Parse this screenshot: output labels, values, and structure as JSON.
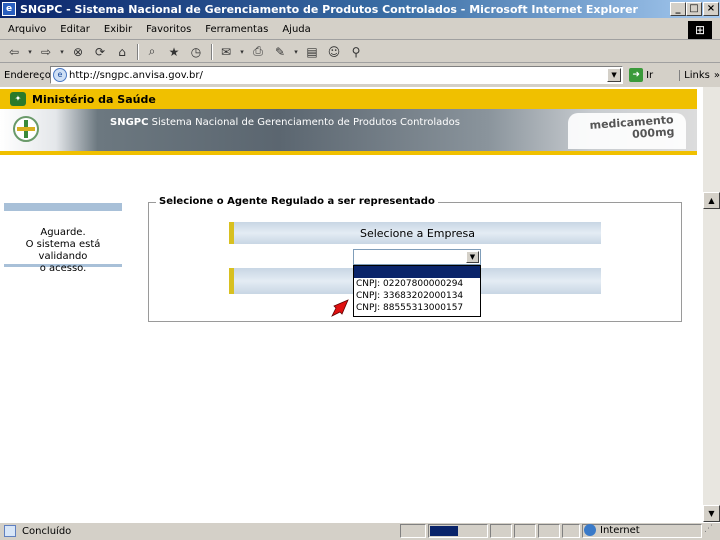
{
  "window": {
    "title": "SNGPC - Sistema Nacional de Gerenciamento de Produtos Controlados - Microsoft Internet Explorer",
    "buttons": {
      "minimize": "_",
      "maximize": "□",
      "close": "×"
    }
  },
  "menubar": {
    "items": [
      "Arquivo",
      "Editar",
      "Exibir",
      "Favoritos",
      "Ferramentas",
      "Ajuda"
    ]
  },
  "toolbar": {
    "icons": [
      "back-icon",
      "dropdown-icon",
      "forward-icon",
      "dropdown-icon",
      "stop-icon",
      "refresh-icon",
      "home-icon",
      "search-icon",
      "favorites-icon",
      "history-icon",
      "mail-icon",
      "print-icon",
      "edit-icon",
      "discuss-icon",
      "messenger-icon",
      "research-icon"
    ]
  },
  "addressbar": {
    "label": "Endereço",
    "url": "http://sngpc.anvisa.gov.br/",
    "go_label": "Ir",
    "links_label": "Links"
  },
  "banner": {
    "ministerio": "Ministério da Saúde",
    "sngpc_bold": "SNGPC",
    "sngpc_rest": " Sistema Nacional de Gerenciamento de Produtos Controlados",
    "med_line1": "medicamento",
    "med_line2": "000mg"
  },
  "sidebar": {
    "line1": "Aguarde.",
    "line2": "O sistema está validando",
    "line3": "o acesso."
  },
  "form": {
    "legend": "Selecione o Agente Regulado a ser representado",
    "header": "Selecione a Empresa",
    "select_value": "",
    "options": [
      "",
      "CNPJ: 02207800000294",
      "CNPJ: 33683202000134",
      "CNPJ: 88555313000157"
    ]
  },
  "statusbar": {
    "status": "Concluído",
    "progress": 0.5,
    "zone": "Internet"
  },
  "colors": {
    "title_blue": "#0a246a",
    "banner_yellow": "#f0c000",
    "selection_highlight": "#0a246a",
    "pointer_red": "#e01010"
  }
}
